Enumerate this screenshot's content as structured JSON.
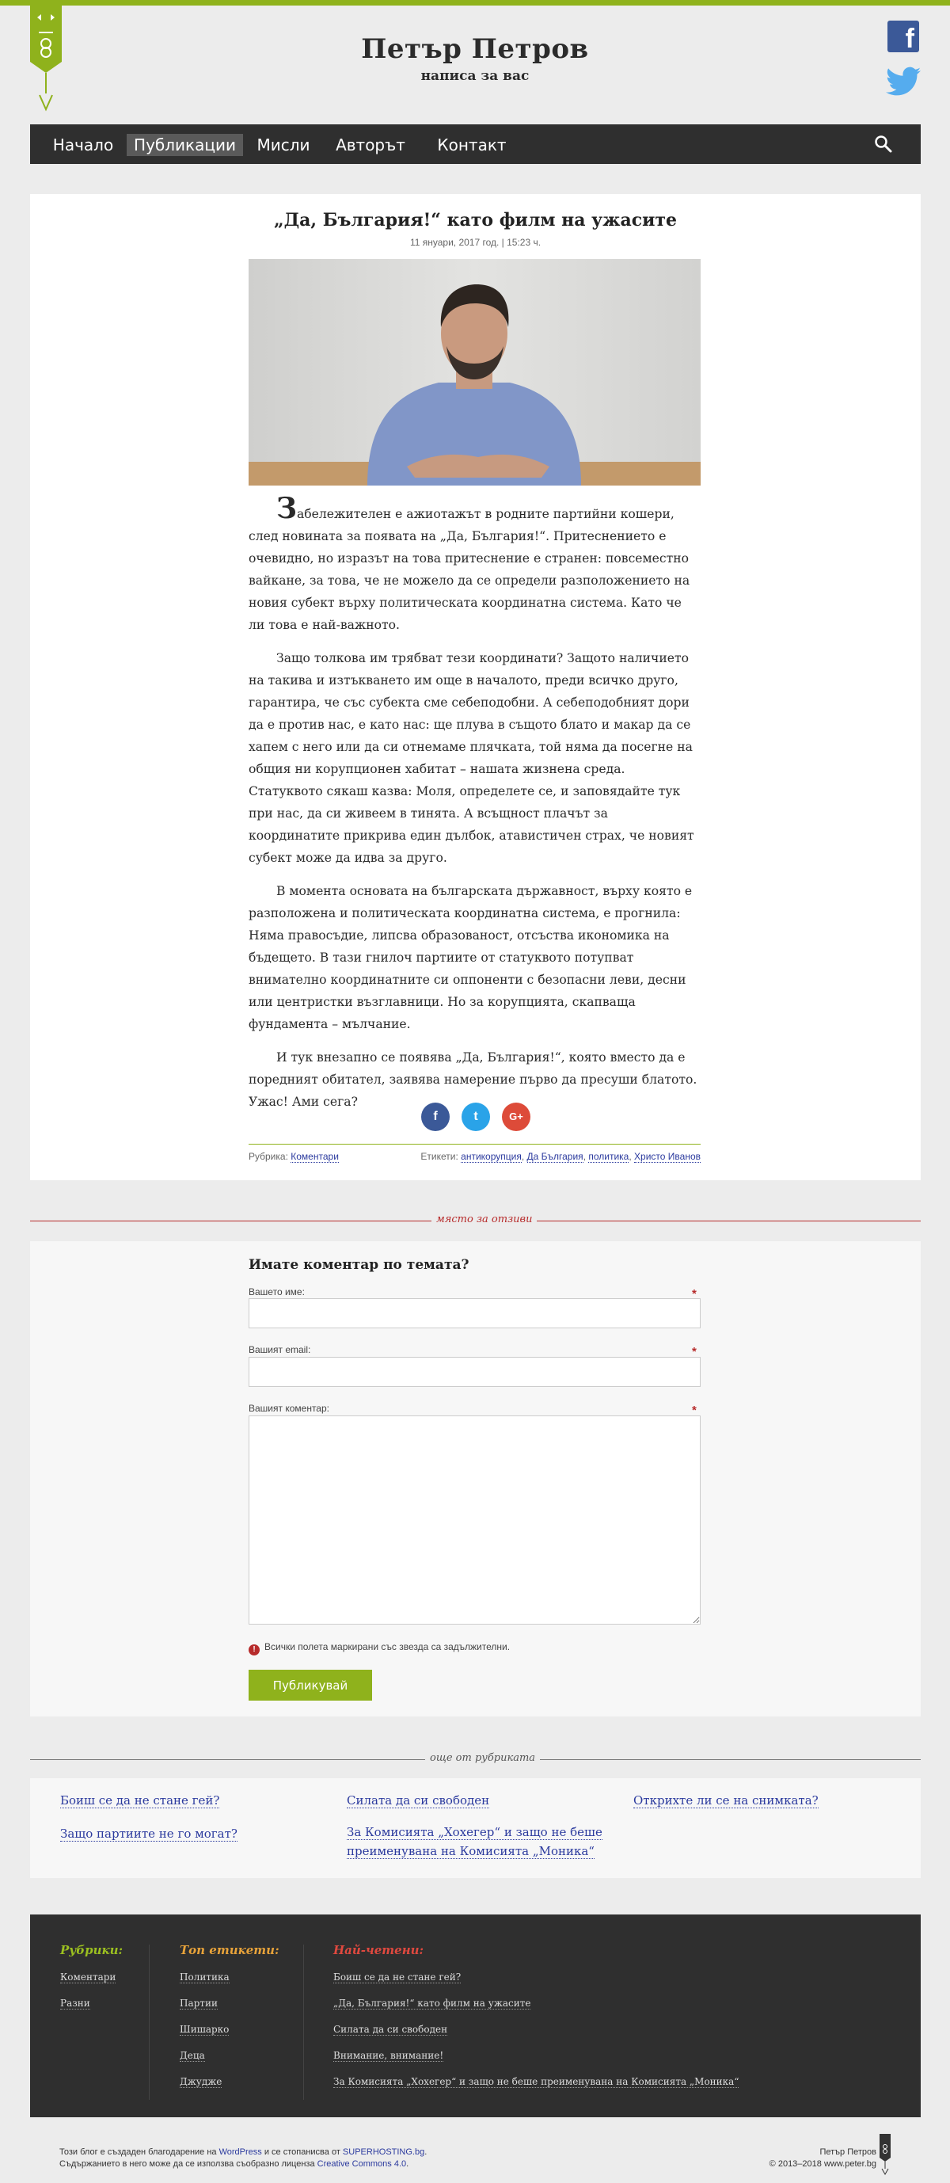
{
  "header": {
    "title": "Петър Петров",
    "subtitle": "написа за вас",
    "facebook_glyph": "f"
  },
  "nav": {
    "items": [
      "Начало",
      "Публикации",
      "Мисли",
      "Авторът",
      "Контакт"
    ],
    "active": "Публикации"
  },
  "article": {
    "title": "„Да, България!“ като филм на ужасите",
    "date": "11 януари, 2017 год. | 15:23 ч.",
    "dropcap": "З",
    "p1_rest": "абележителен е ажиотажът в родните партийни кошери, след новината за появата на „Да, България!“. Притеснението е очевидно, но изразът на това притеснение е странен: повсеместно вайкане, за това, че не можело да се определи разположението на новия субект върху политическата координатна система. Като че ли това е най-важното.",
    "p2": "Защо толкова им трябват тези координати? Защото наличието на такива и изтъкването им още в началото, преди всичко друго, гарантира, че със субекта сме себеподобни. А себеподобният дори да е против нас, е като нас: ще плува в същото блато и макар да се хапем с него или да си отнемаме плячката, той няма да посегне на общия ни корупционен хабитат – нашата жизнена среда. Статуквото сякаш казва: Моля, определете се, и заповядайте тук при нас, да си живеем в тинята. А всъщност плачът за координатите прикрива един дълбок, атавистичен страх, че новият субект може да идва за друго.",
    "p3": "В момента основата на българската държавност, върху която е разположена и политическата координатна система, е прогнила: Няма правосъдие, липсва образованост, отсъства икономика на бъдещето. В тази гнилоч партиите от статуквото потупват внимателно координатните си оппоненти с безопасни леви, десни или центристки възглавници. Но за корупцията, скапваща фундамента – мълчание.",
    "p4": "И тук внезапно се появява „Да, България!“, която вместо да е поредният обитател, заявява намерение първо да пресуши блатото. Ужас! Ами сега?",
    "share": [
      "f",
      "t",
      "G+"
    ],
    "category_label": "Рубрика:",
    "category": "Коментари",
    "tags_label": "Етикети:",
    "tags": [
      "антикорупция",
      "Да България",
      "политика",
      "Христо Иванов"
    ]
  },
  "comment_divider": "място за отзиви",
  "comment_form": {
    "title": "Имате коментар по темата?",
    "name_label": "Вашето име:",
    "email_label": "Вашият email:",
    "comment_label": "Вашият коментар:",
    "required_note": "Всички полета маркирани със звезда са задължителни.",
    "required_icon": "!",
    "required_star": "*",
    "submit": "Публикувай"
  },
  "related_divider": "още от рубриката",
  "related": [
    "Боиш се да не стане гей?",
    "Защо партиите не го могат?",
    "Силата да си свободен",
    "За Комисията „Хохегер“ и защо не беше преименувана на Комисията „Моника“",
    "Открихте ли се на снимката?"
  ],
  "footer": {
    "rubrics_title": "Рубрики:",
    "rubrics": [
      "Коментари",
      "Разни"
    ],
    "tags_title": "Топ етикети:",
    "tags": [
      "Политика",
      "Партии",
      "Шишарко",
      "Деца",
      "Джудже"
    ],
    "popular_title": "Най-четени:",
    "popular": [
      "Боиш се да не стане гей?",
      "„Да, България!“ като филм на ужасите",
      "Силата да си свободен",
      "Внимание, внимание!",
      "За Комисията „Хохегер“ и защо не беше преименувана на Комисията „Моника“"
    ],
    "colors": {
      "rubrics": "#9cc020",
      "tags": "#e8a33a",
      "popular": "#e0493f"
    }
  },
  "credits": {
    "l1_a": "Този блог е създаден благодарение на ",
    "l1_b": "WordPress",
    "l1_c": " и се стопанисва от ",
    "l1_d": "SUPERHOSTING.bg",
    "l1_e": ".",
    "l2_a": "Съдържанието в него може да се използва съобразно лиценза ",
    "l2_b": "Creative Commons 4.0",
    "l2_c": ".",
    "right_1": "Петър Петров",
    "right_2": "© 2013–2018 www.peter.bg"
  }
}
